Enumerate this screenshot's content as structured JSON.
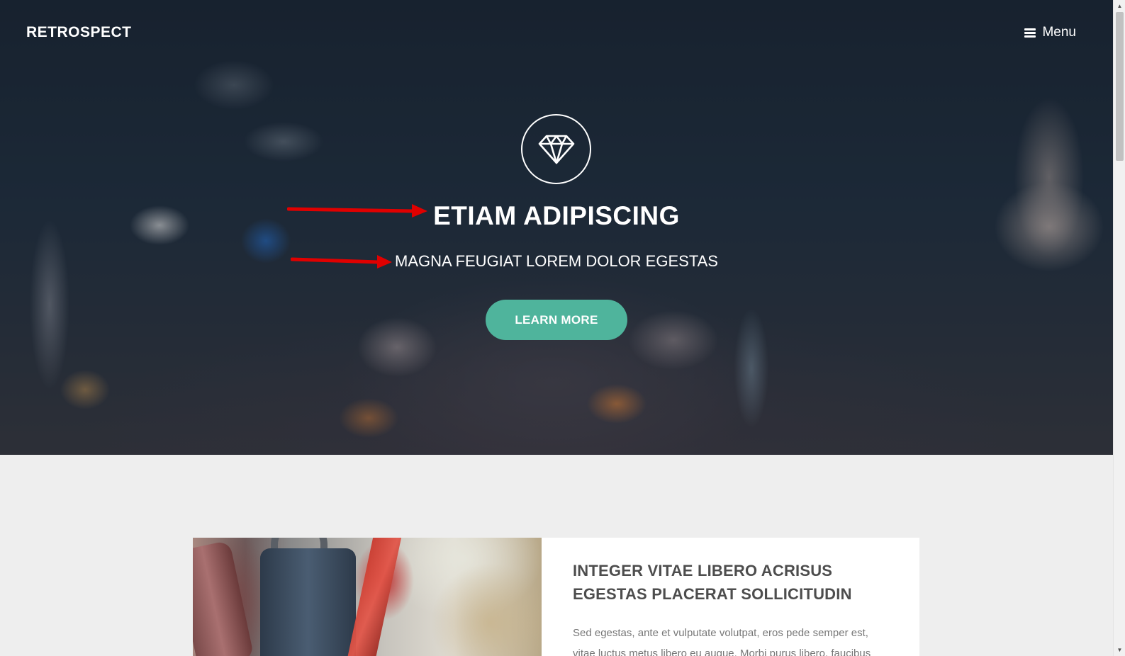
{
  "header": {
    "brand": "RETROSPECT",
    "menu_label": "Menu",
    "menu_icon": "hamburger-icon"
  },
  "hero": {
    "icon": "diamond-icon",
    "title": "ETIAM ADIPISCING",
    "subtitle": "MAGNA FEUGIAT LOREM DOLOR EGESTAS",
    "button_label": "LEARN MORE",
    "annotation_color": "#e00000"
  },
  "feature": {
    "title": "INTEGER VITAE LIBERO ACRISUS EGESTAS PLACERAT SOLLICITUDIN",
    "body": "Sed egestas, ante et vulputate volutpat, eros pede semper est, vitae luctus metus libero eu augue. Morbi purus libero, faucibus"
  },
  "colors": {
    "accent": "#4fb49c",
    "hero_overlay": "#1c2836",
    "page_background": "#eeeeee"
  }
}
